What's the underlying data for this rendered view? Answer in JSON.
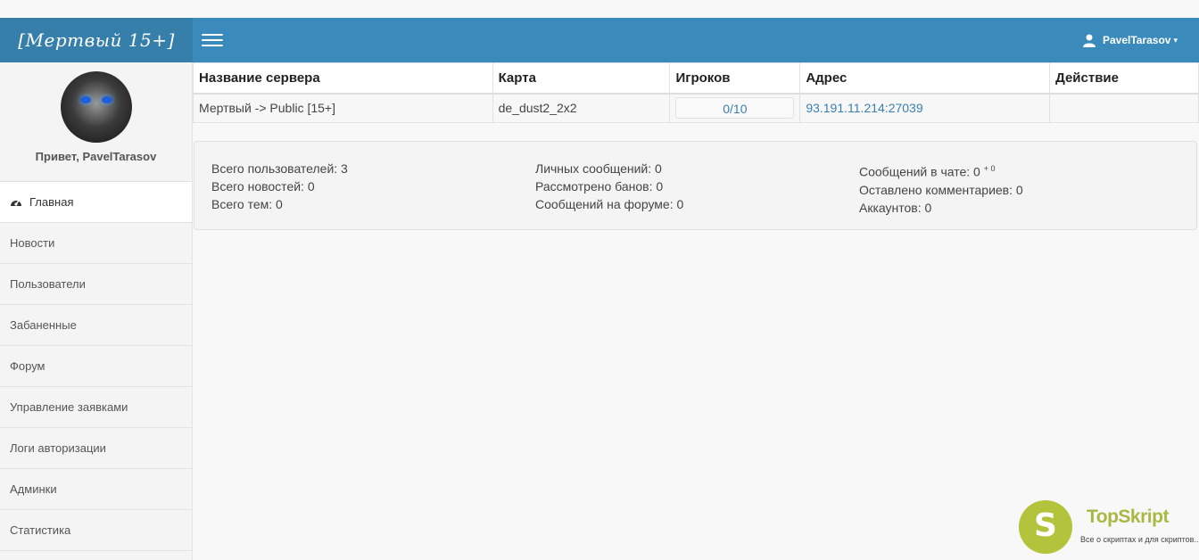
{
  "header": {
    "brand": "[Мертвый 15+]",
    "username": "PavelTarasov",
    "caret": "▾"
  },
  "sidebar": {
    "greeting": "Привет, PavelTarasov",
    "items": [
      {
        "label": "Главная",
        "icon": "dashboard-icon"
      },
      {
        "label": "Новости"
      },
      {
        "label": "Пользователи"
      },
      {
        "label": "Забаненные"
      },
      {
        "label": "Форум"
      },
      {
        "label": "Управление заявками"
      },
      {
        "label": "Логи авторизации"
      },
      {
        "label": "Админки"
      },
      {
        "label": "Статистика"
      }
    ]
  },
  "servers": {
    "headers": [
      "Название сервера",
      "Карта",
      "Игроков",
      "Адрес",
      "Действие"
    ],
    "rows": [
      {
        "name": "Мертвый -> Public [15+]",
        "map": "de_dust2_2x2",
        "players": "0/10",
        "address": "93.191.11.214:27039",
        "action": ""
      }
    ]
  },
  "stats": {
    "users": "Всего пользователей: 3",
    "news": "Всего новостей: 0",
    "topics": "Всего тем: 0",
    "pm": "Личных сообщений: 0",
    "bans": "Рассмотрено банов: 0",
    "forum_msgs": "Сообщений на форуме: 0",
    "chat": "Сообщений в чате: 0",
    "chat_sup": "+ 0",
    "comments": "Оставлено комментариев: 0",
    "accounts": "Аккаунтов: 0"
  },
  "watermark": {
    "letter": "S",
    "title": "TopSkript",
    "subtitle": "Все о скриптах и для скриптов..."
  },
  "colors": {
    "navbar": "#3a8bbb",
    "brand_bg": "#367fab",
    "link": "#3a7fb0",
    "watermark": "#b3c43c"
  }
}
